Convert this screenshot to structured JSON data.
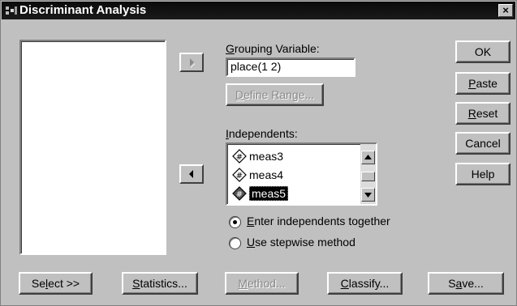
{
  "window": {
    "title": "Discriminant Analysis",
    "close_glyph": "×"
  },
  "grouping": {
    "label_first": "G",
    "label_rest": "rouping Variable:",
    "value": "place(1 2)"
  },
  "define_range": {
    "label_first": "D",
    "label_rest": "efine Range..."
  },
  "independents": {
    "label_first": "I",
    "label_rest": "ndependents:",
    "items": [
      "meas3",
      "meas4",
      "meas5"
    ],
    "selected_index": 2
  },
  "method_options": {
    "together": {
      "label_first": "E",
      "label_rest": "nter independents together",
      "checked": true
    },
    "stepwise": {
      "label_first": "U",
      "label_rest": "se stepwise method",
      "checked": false
    }
  },
  "right_buttons": {
    "ok": "OK",
    "paste_first": "P",
    "paste_rest": "aste",
    "reset_first": "R",
    "reset_rest": "eset",
    "cancel": "Cancel",
    "help": "Help"
  },
  "bottom_buttons": {
    "select_pre": "Se",
    "select_u": "l",
    "select_post": "ect >>",
    "statistics_first": "S",
    "statistics_rest": "tatistics...",
    "method_first": "M",
    "method_rest": "ethod...",
    "classify_first": "C",
    "classify_rest": "lassify...",
    "save_pre": "S",
    "save_u": "a",
    "save_post": "ve..."
  },
  "icons": {
    "move_right": "arrow-right-icon",
    "move_left": "arrow-left-icon",
    "variable": "scale-variable-icon",
    "app": "spss-dialog-icon"
  }
}
